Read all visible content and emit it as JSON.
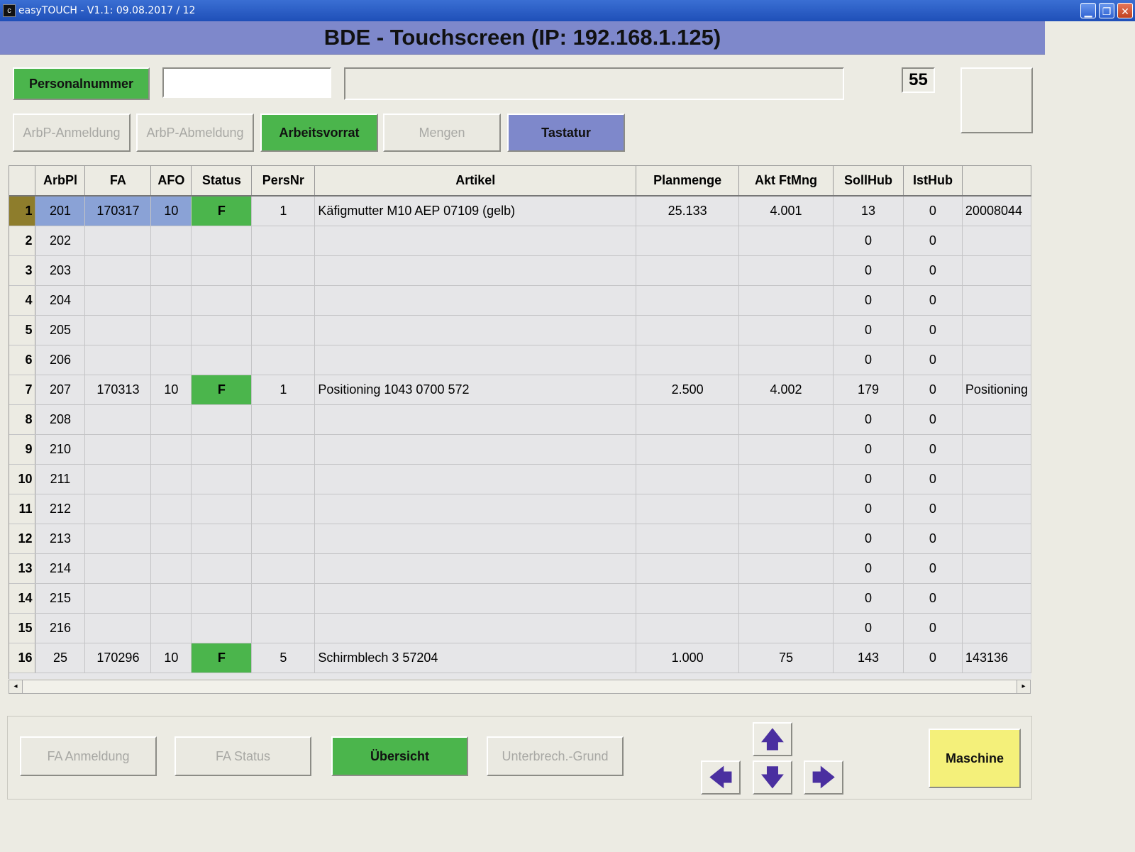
{
  "window": {
    "title": "easyTOUCH - V1.1:  09.08.2017 / 12",
    "app_icon": "c",
    "minimize_glyph": "▁",
    "maximize_glyph": "❐",
    "close_glyph": "✕"
  },
  "header": {
    "title": "BDE - Touchscreen (IP: 192.168.1.125)"
  },
  "toprow": {
    "personalnummer_label": "Personalnummer",
    "personalnummer_value": "",
    "info_value": "",
    "counter": "55"
  },
  "tabs": {
    "arbp_anmeldung": "ArbP-Anmeldung",
    "arbp_abmeldung": "ArbP-Abmeldung",
    "arbeitsvorrat": "Arbeitsvorrat",
    "mengen": "Mengen",
    "tastatur": "Tastatur"
  },
  "table": {
    "columns": [
      "",
      "ArbPl",
      "FA",
      "AFO",
      "Status",
      "PersNr",
      "Artikel",
      "Planmenge",
      "Akt FtMng",
      "SollHub",
      "IstHub",
      ""
    ],
    "rows": [
      [
        "1",
        "201",
        "170317",
        "10",
        "F",
        "1",
        "Käfigmutter M10  AEP 07109  (gelb)",
        "25.133",
        "4.001",
        "13",
        "0",
        "20008044"
      ],
      [
        "2",
        "202",
        "",
        "",
        "",
        "",
        "",
        "",
        "",
        "0",
        "0",
        ""
      ],
      [
        "3",
        "203",
        "",
        "",
        "",
        "",
        "",
        "",
        "",
        "0",
        "0",
        ""
      ],
      [
        "4",
        "204",
        "",
        "",
        "",
        "",
        "",
        "",
        "",
        "0",
        "0",
        ""
      ],
      [
        "5",
        "205",
        "",
        "",
        "",
        "",
        "",
        "",
        "",
        "0",
        "0",
        ""
      ],
      [
        "6",
        "206",
        "",
        "",
        "",
        "",
        "",
        "",
        "",
        "0",
        "0",
        ""
      ],
      [
        "7",
        "207",
        "170313",
        "10",
        "F",
        "1",
        "Positioning 1043 0700 572",
        "2.500",
        "4.002",
        "179",
        "0",
        "Positioning"
      ],
      [
        "8",
        "208",
        "",
        "",
        "",
        "",
        "",
        "",
        "",
        "0",
        "0",
        ""
      ],
      [
        "9",
        "210",
        "",
        "",
        "",
        "",
        "",
        "",
        "",
        "0",
        "0",
        ""
      ],
      [
        "10",
        "211",
        "",
        "",
        "",
        "",
        "",
        "",
        "",
        "0",
        "0",
        ""
      ],
      [
        "11",
        "212",
        "",
        "",
        "",
        "",
        "",
        "",
        "",
        "0",
        "0",
        ""
      ],
      [
        "12",
        "213",
        "",
        "",
        "",
        "",
        "",
        "",
        "",
        "0",
        "0",
        ""
      ],
      [
        "13",
        "214",
        "",
        "",
        "",
        "",
        "",
        "",
        "",
        "0",
        "0",
        ""
      ],
      [
        "14",
        "215",
        "",
        "",
        "",
        "",
        "",
        "",
        "",
        "0",
        "0",
        ""
      ],
      [
        "15",
        "216",
        "",
        "",
        "",
        "",
        "",
        "",
        "",
        "0",
        "0",
        ""
      ],
      [
        "16",
        "25",
        "170296",
        "10",
        "F",
        "5",
        "Schirmblech 3 57204",
        "1.000",
        "75",
        "143",
        "0",
        "143136"
      ]
    ],
    "status_color": "#4bb54c",
    "selected_color": "#8aa2d6",
    "scroll_left": "◂",
    "scroll_right": "▸"
  },
  "bottom": {
    "fa_anmeldung": "FA Anmeldung",
    "fa_status": "FA Status",
    "uebersicht": "Übersicht",
    "unterbrech_grund": "Unterbrech.-Grund",
    "maschine": "Maschine",
    "arrow_up": "🡅",
    "arrow_left": "🡄",
    "arrow_down": "🡇",
    "arrow_right": "🡆"
  },
  "colors": {
    "accent_blue": "#7e88cb",
    "accent_green": "#4bb54c",
    "accent_yellow": "#f4f07a",
    "background": "#ecebe3"
  }
}
